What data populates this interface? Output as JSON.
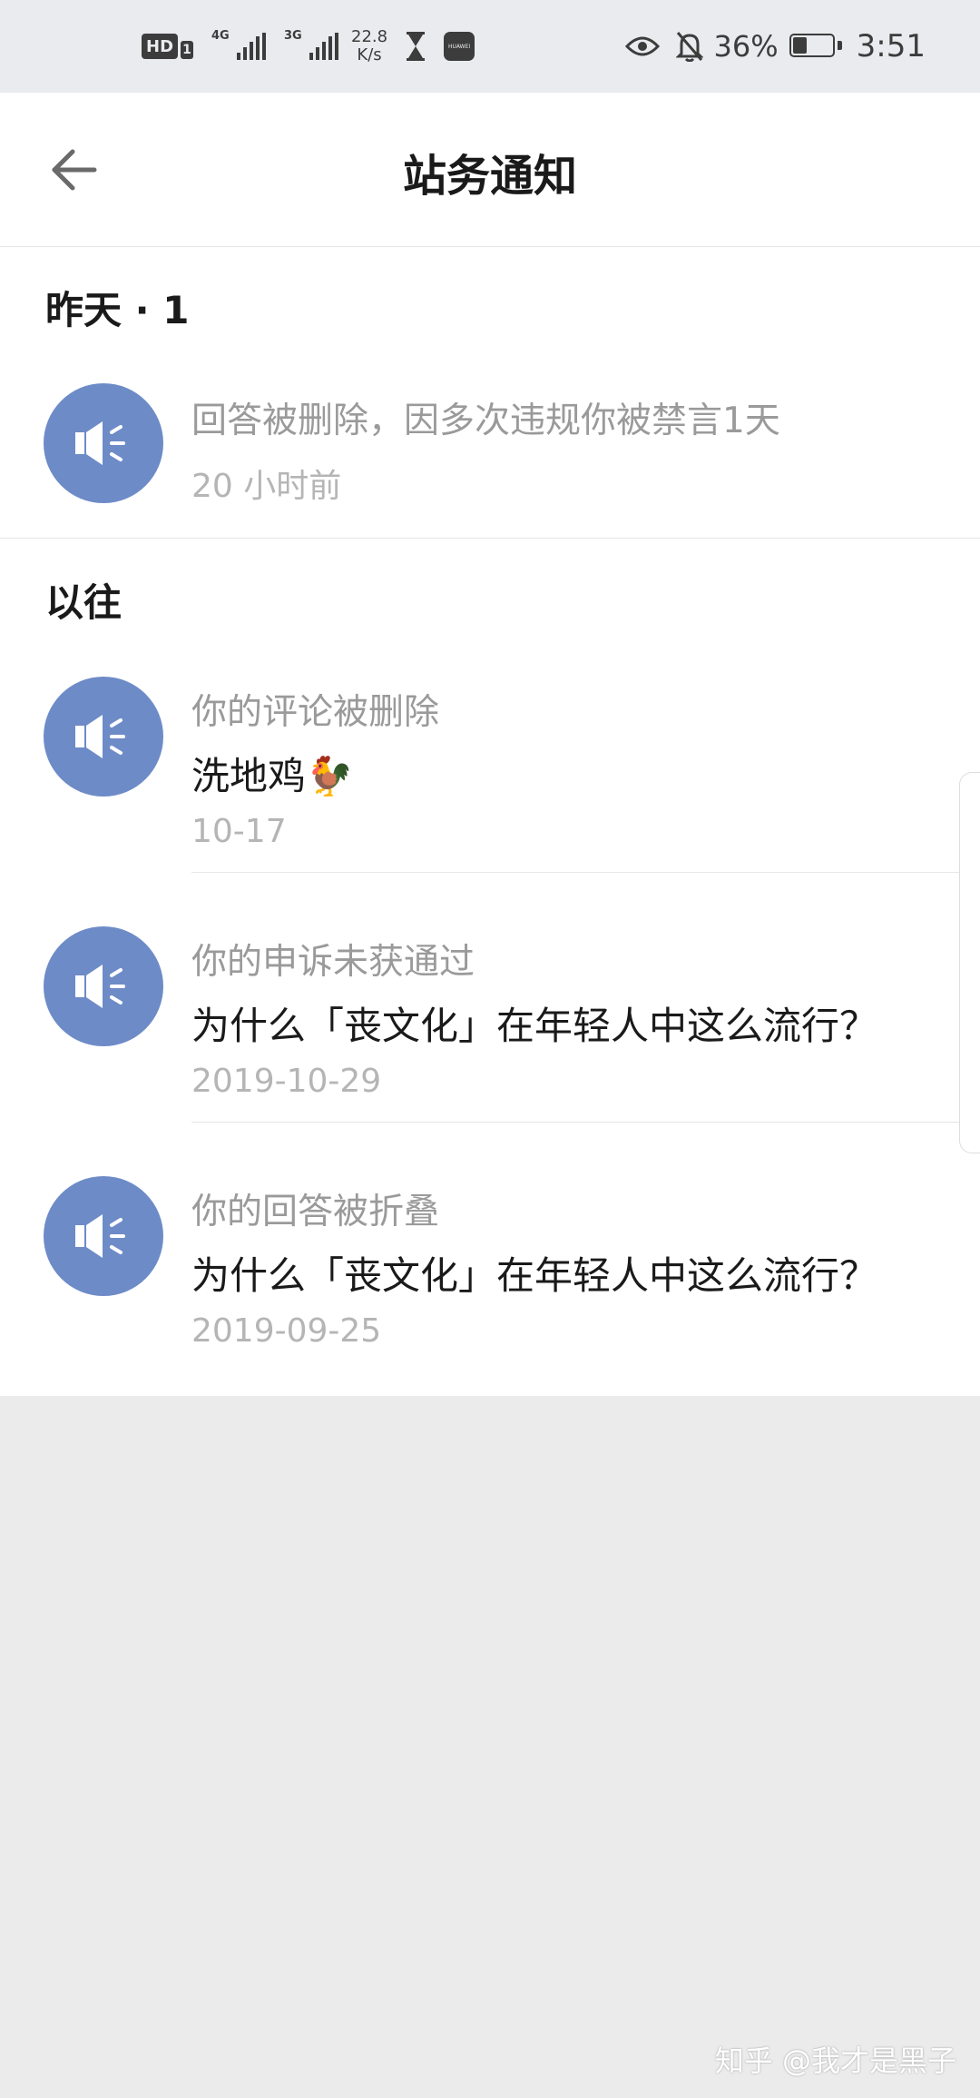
{
  "status_bar": {
    "hd_label": "HD",
    "hd_num": "1",
    "sig1_label": "4G",
    "sig2_label": "3G",
    "speed_value": "22.8",
    "speed_unit": "K/s",
    "battery_percent": "36%",
    "battery_level": 0.36,
    "time": "3:51"
  },
  "header": {
    "title": "站务通知"
  },
  "sections": [
    {
      "label": "昨天 · 1",
      "items": [
        {
          "title": "回答被删除，因多次违规你被禁言1天",
          "body": "",
          "time": "20 小时前"
        }
      ]
    },
    {
      "label": "以往",
      "items": [
        {
          "title": "你的评论被删除",
          "body": "洗地鸡🐓",
          "time": "10-17"
        },
        {
          "title": "你的申诉未获通过",
          "body": "为什么「丧文化」在年轻人中这么流行？",
          "time": "2019-10-29"
        },
        {
          "title": "你的回答被折叠",
          "body": "为什么「丧文化」在年轻人中这么流行？",
          "time": "2019-09-25"
        }
      ]
    }
  ],
  "watermark": "知乎 @我才是黑子",
  "colors": {
    "avatar": "#6d8bc7",
    "background": "#ebebeb"
  }
}
